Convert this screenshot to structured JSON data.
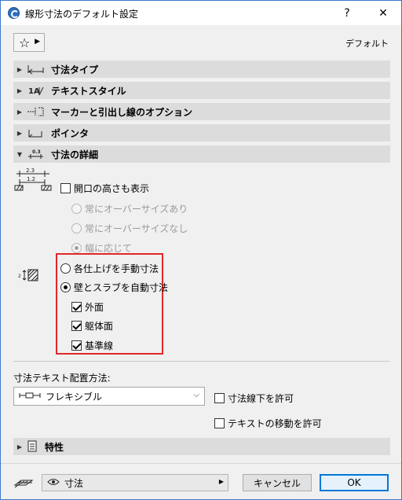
{
  "window": {
    "title": "線形寸法のデフォルト設定",
    "help": "?",
    "close": "✕"
  },
  "toolbar": {
    "favorites_icon": "star-icon",
    "preset_label": "デフォルト"
  },
  "sections": [
    {
      "label": "寸法タイプ",
      "expanded": false
    },
    {
      "label": "テキストスタイル",
      "expanded": false
    },
    {
      "label": "マーカーと引出し線のオプション",
      "expanded": false
    },
    {
      "label": "ポインタ",
      "expanded": false
    },
    {
      "label": "寸法の詳細",
      "expanded": true
    }
  ],
  "details": {
    "preview_top": "2.3",
    "preview_bottom": "1.2",
    "show_opening_height": {
      "label": "開口の高さも表示",
      "checked": false
    },
    "opening_options": [
      {
        "label": "常にオーバーサイズあり",
        "selected": false
      },
      {
        "label": "常にオーバーサイズなし",
        "selected": false
      },
      {
        "label": "幅に応じて",
        "selected": true
      }
    ],
    "finish_options": [
      {
        "label": "各仕上げを手動寸法",
        "selected": false
      },
      {
        "label": "壁とスラブを自動寸法",
        "selected": true
      }
    ],
    "surfaces": [
      {
        "label": "外面",
        "checked": true
      },
      {
        "label": "躯体面",
        "checked": true
      },
      {
        "label": "基準線",
        "checked": true
      }
    ]
  },
  "placement": {
    "label": "寸法テキスト配置方法:",
    "selected": "フレキシブル",
    "allow_below": {
      "label": "寸法線下を許可",
      "checked": false
    },
    "allow_move": {
      "label": "テキストの移動を許可",
      "checked": false
    }
  },
  "properties": {
    "label": "特性"
  },
  "footer": {
    "layer": "寸法",
    "cancel_label": "キャンセル",
    "ok_label": "OK"
  },
  "colors": {
    "highlight_box": "#e0282a",
    "title_border": "#3c78c8",
    "ok_border": "#0078d7"
  }
}
